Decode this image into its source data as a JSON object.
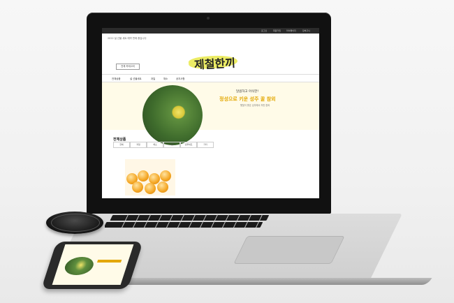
{
  "scene": {
    "laptop_site": {
      "topbar_links": [
        "로그인",
        "회원가입",
        "마이페이지",
        "장바구니"
      ],
      "notice": "2022 설 선물 세트 예약 판매 중입니다",
      "logo_text": "제철한끼",
      "category_button": "전체 카테고리",
      "nav_items": [
        "전체상품",
        "설 선물세트",
        "과일",
        "채소",
        "공지사항"
      ],
      "banner": {
        "line1": "달콤하고 아삭한!",
        "line2": "정성으로 키운 성주 꿀 참외",
        "line3": "햇빛이 좋은 성주에서 자란 참외"
      },
      "section_title": "전체상품",
      "tabs": [
        "전체",
        "과일",
        "채소",
        "곡물",
        "선물세트",
        "기타"
      ]
    },
    "colors": {
      "accent_yellow": "#e3a700",
      "logo_swoosh": "#e9e94a",
      "banner_bg": "#fffbe8",
      "laptop_frame": "#111111"
    },
    "objects": [
      "laptop",
      "lens-cap",
      "smartphone"
    ]
  }
}
